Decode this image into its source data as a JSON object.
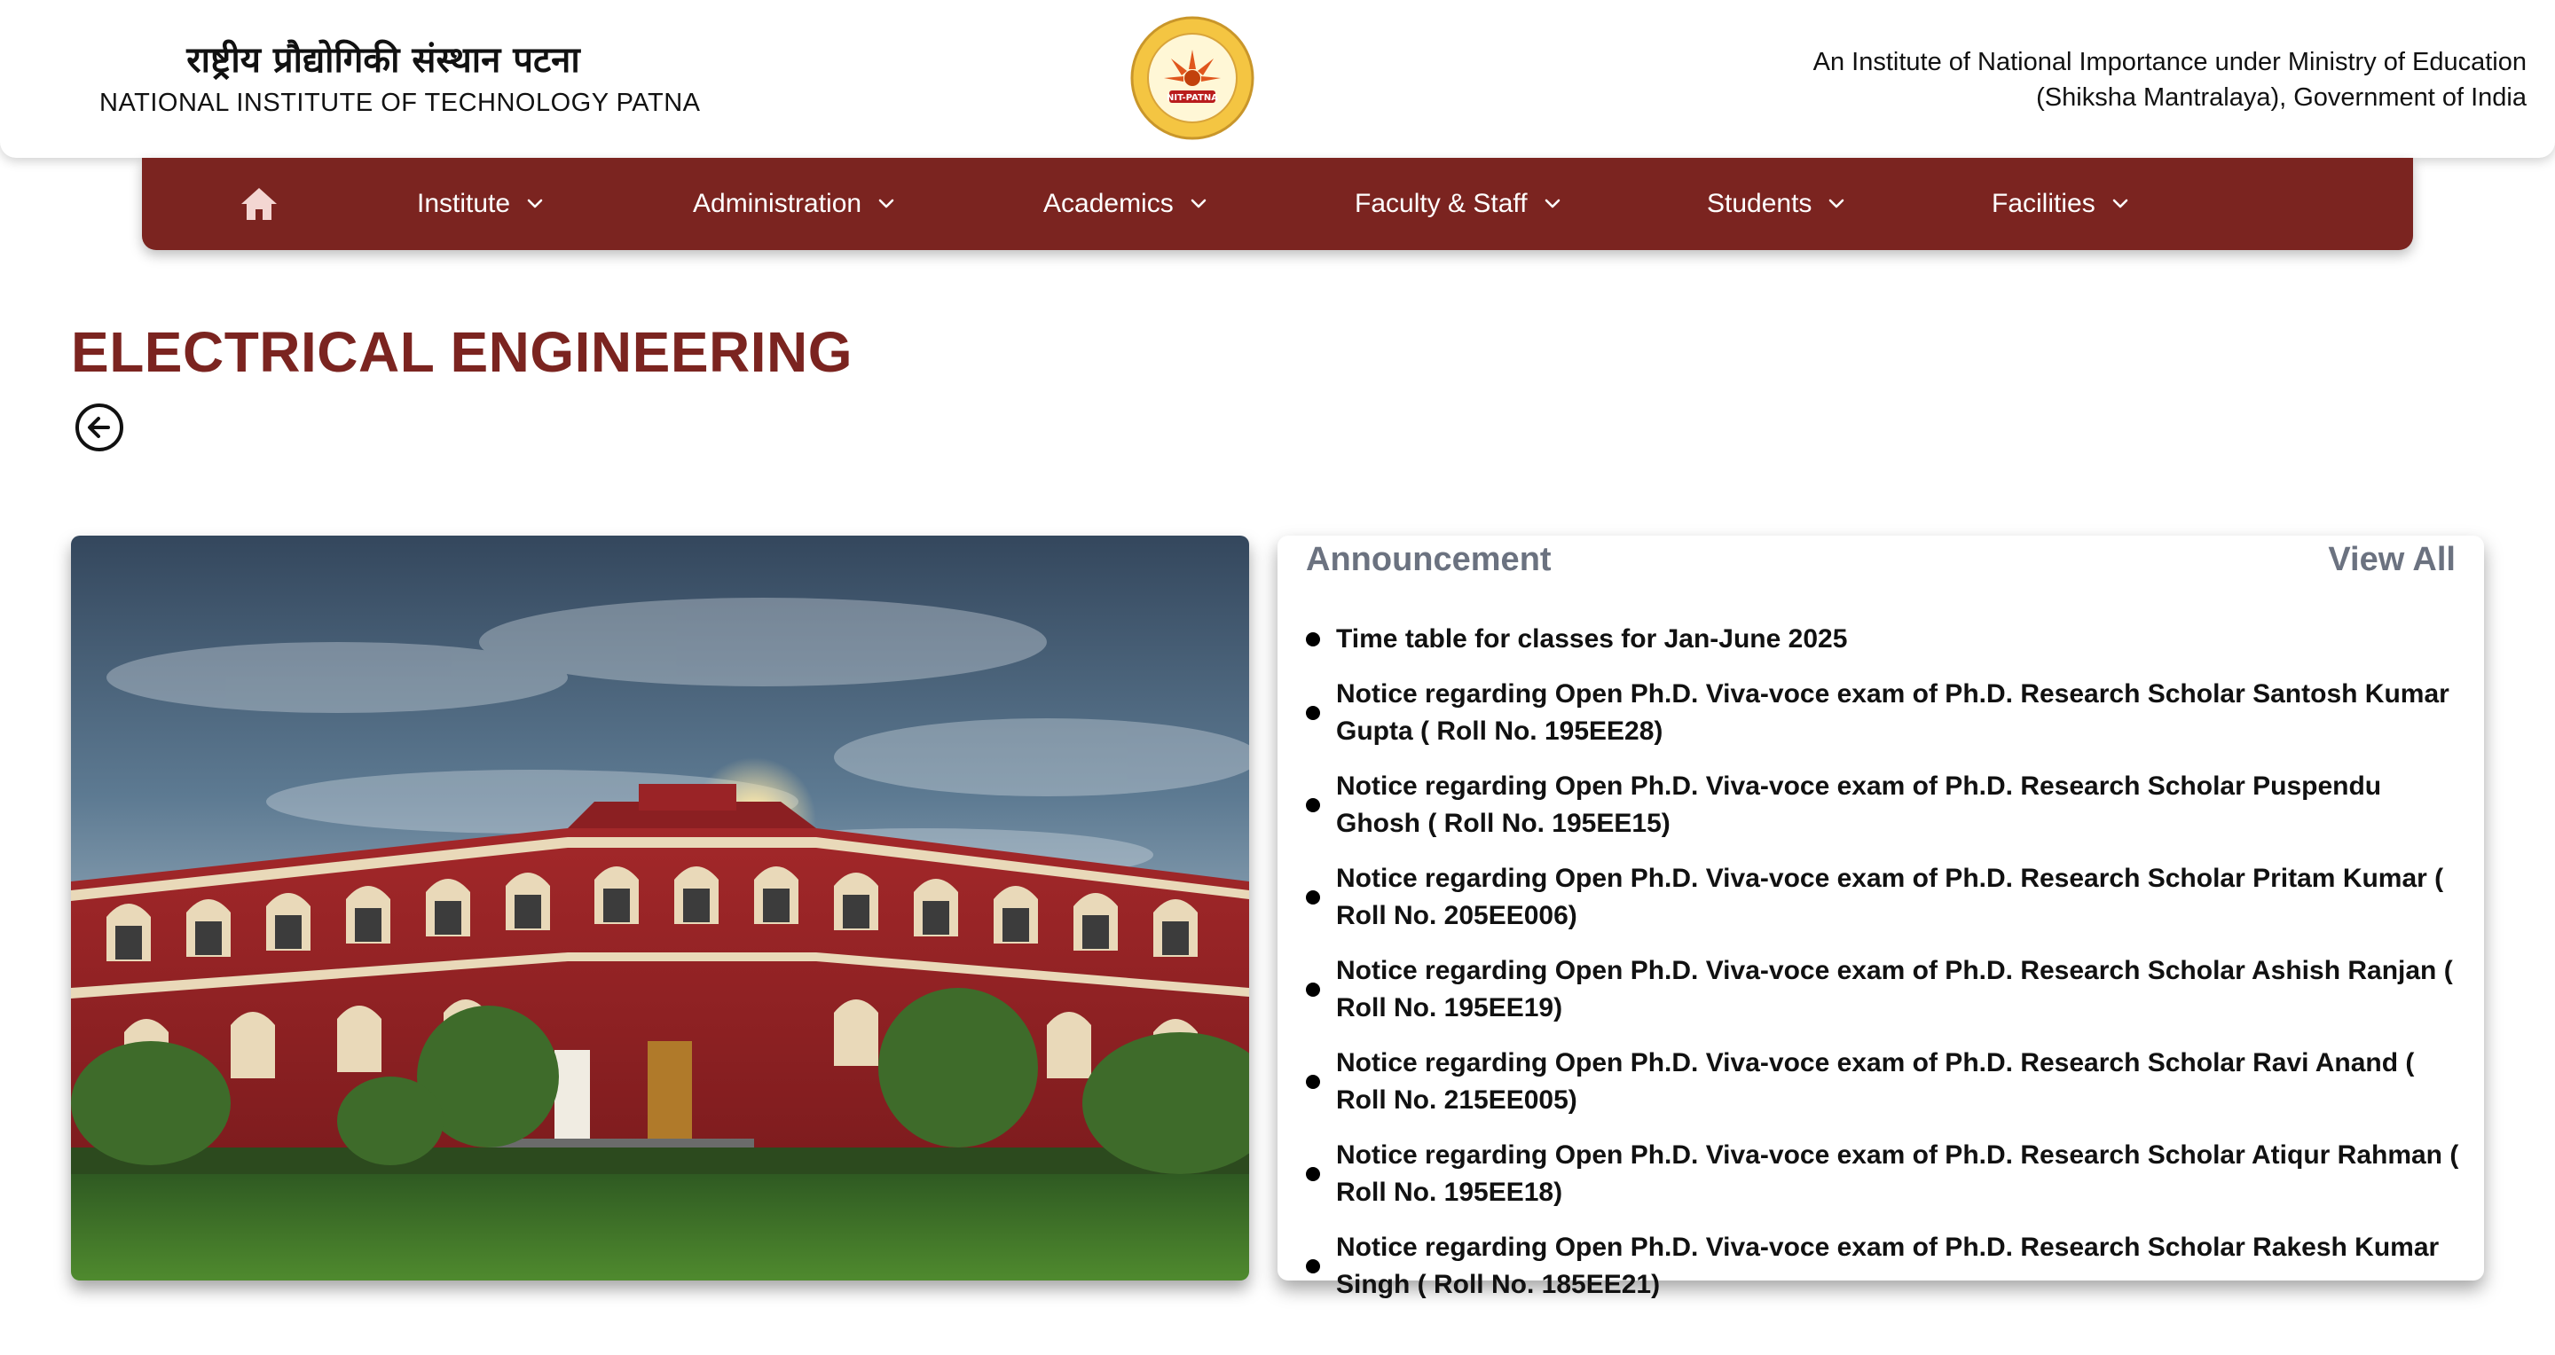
{
  "header": {
    "hindi_name": "राष्ट्रीय प्रौद्योगिकी संस्थान पटना",
    "english_name": "NATIONAL INSTITUTE OF TECHNOLOGY PATNA",
    "logo_text": "NIT-PATNA",
    "tagline_line1": "An Institute of National Importance under Ministry of Education",
    "tagline_line2": "(Shiksha Mantralaya), Government of India"
  },
  "nav": {
    "home_icon": "home-icon",
    "items": [
      {
        "label": "Institute"
      },
      {
        "label": "Administration"
      },
      {
        "label": "Academics"
      },
      {
        "label": "Faculty & Staff"
      },
      {
        "label": "Students"
      },
      {
        "label": "Facilities"
      }
    ]
  },
  "page": {
    "title": "ELECTRICAL ENGINEERING",
    "back_icon": "arrow-left-circle-icon"
  },
  "announcements": {
    "title": "Announcement",
    "view_all": "View All",
    "items": [
      "Time table for classes for Jan-June 2025",
      "Notice regarding Open Ph.D. Viva-voce exam of Ph.D. Research Scholar Santosh Kumar Gupta ( Roll No. 195EE28)",
      "Notice regarding Open Ph.D. Viva-voce exam of Ph.D. Research Scholar Puspendu Ghosh ( Roll No. 195EE15)",
      "Notice regarding Open Ph.D. Viva-voce exam of Ph.D. Research Scholar Pritam Kumar ( Roll No. 205EE006)",
      "Notice regarding Open Ph.D. Viva-voce exam of Ph.D. Research Scholar Ashish Ranjan ( Roll No. 195EE19)",
      "Notice regarding Open Ph.D. Viva-voce exam of Ph.D. Research Scholar Ravi Anand ( Roll No. 215EE005)",
      "Notice regarding Open Ph.D. Viva-voce exam of Ph.D. Research Scholar Atiqur Rahman ( Roll No. 195EE18)",
      "Notice regarding Open Ph.D. Viva-voce exam of Ph.D. Research Scholar Rakesh Kumar Singh ( Roll No. 185EE21)"
    ]
  },
  "colors": {
    "brand_maroon": "#7b2420",
    "announcement_heading": "#6b7280"
  }
}
